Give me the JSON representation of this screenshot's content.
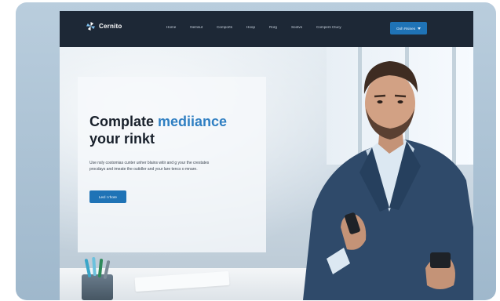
{
  "nav": {
    "logo_text": "Cernito",
    "logo_icon": "pinwheel-logo-icon",
    "items": [
      {
        "label": "Home"
      },
      {
        "label": "Nemsut"
      },
      {
        "label": "Comports"
      },
      {
        "label": "Hoop"
      },
      {
        "label": "Rorg"
      },
      {
        "label": "Sootvs"
      },
      {
        "label": "Compers Ctucy"
      }
    ],
    "cta_label": "Ooh Rsines",
    "cta_icon": "chevron-down-icon"
  },
  "hero": {
    "headline_line1_plain": "Complate ",
    "headline_line1_accent": "mediiance",
    "headline_line2": "your rinkt",
    "body_line1": "Use nsly costomias cunter unher blains witir and g your the crestates",
    "body_line2": "procdays and imeate the outidler and your lare tencs o mnare.",
    "button_label": "Lecl I rhore"
  },
  "colors": {
    "nav_bg": "#1d2836",
    "accent": "#2f7fc2",
    "button": "#1f73b6"
  }
}
